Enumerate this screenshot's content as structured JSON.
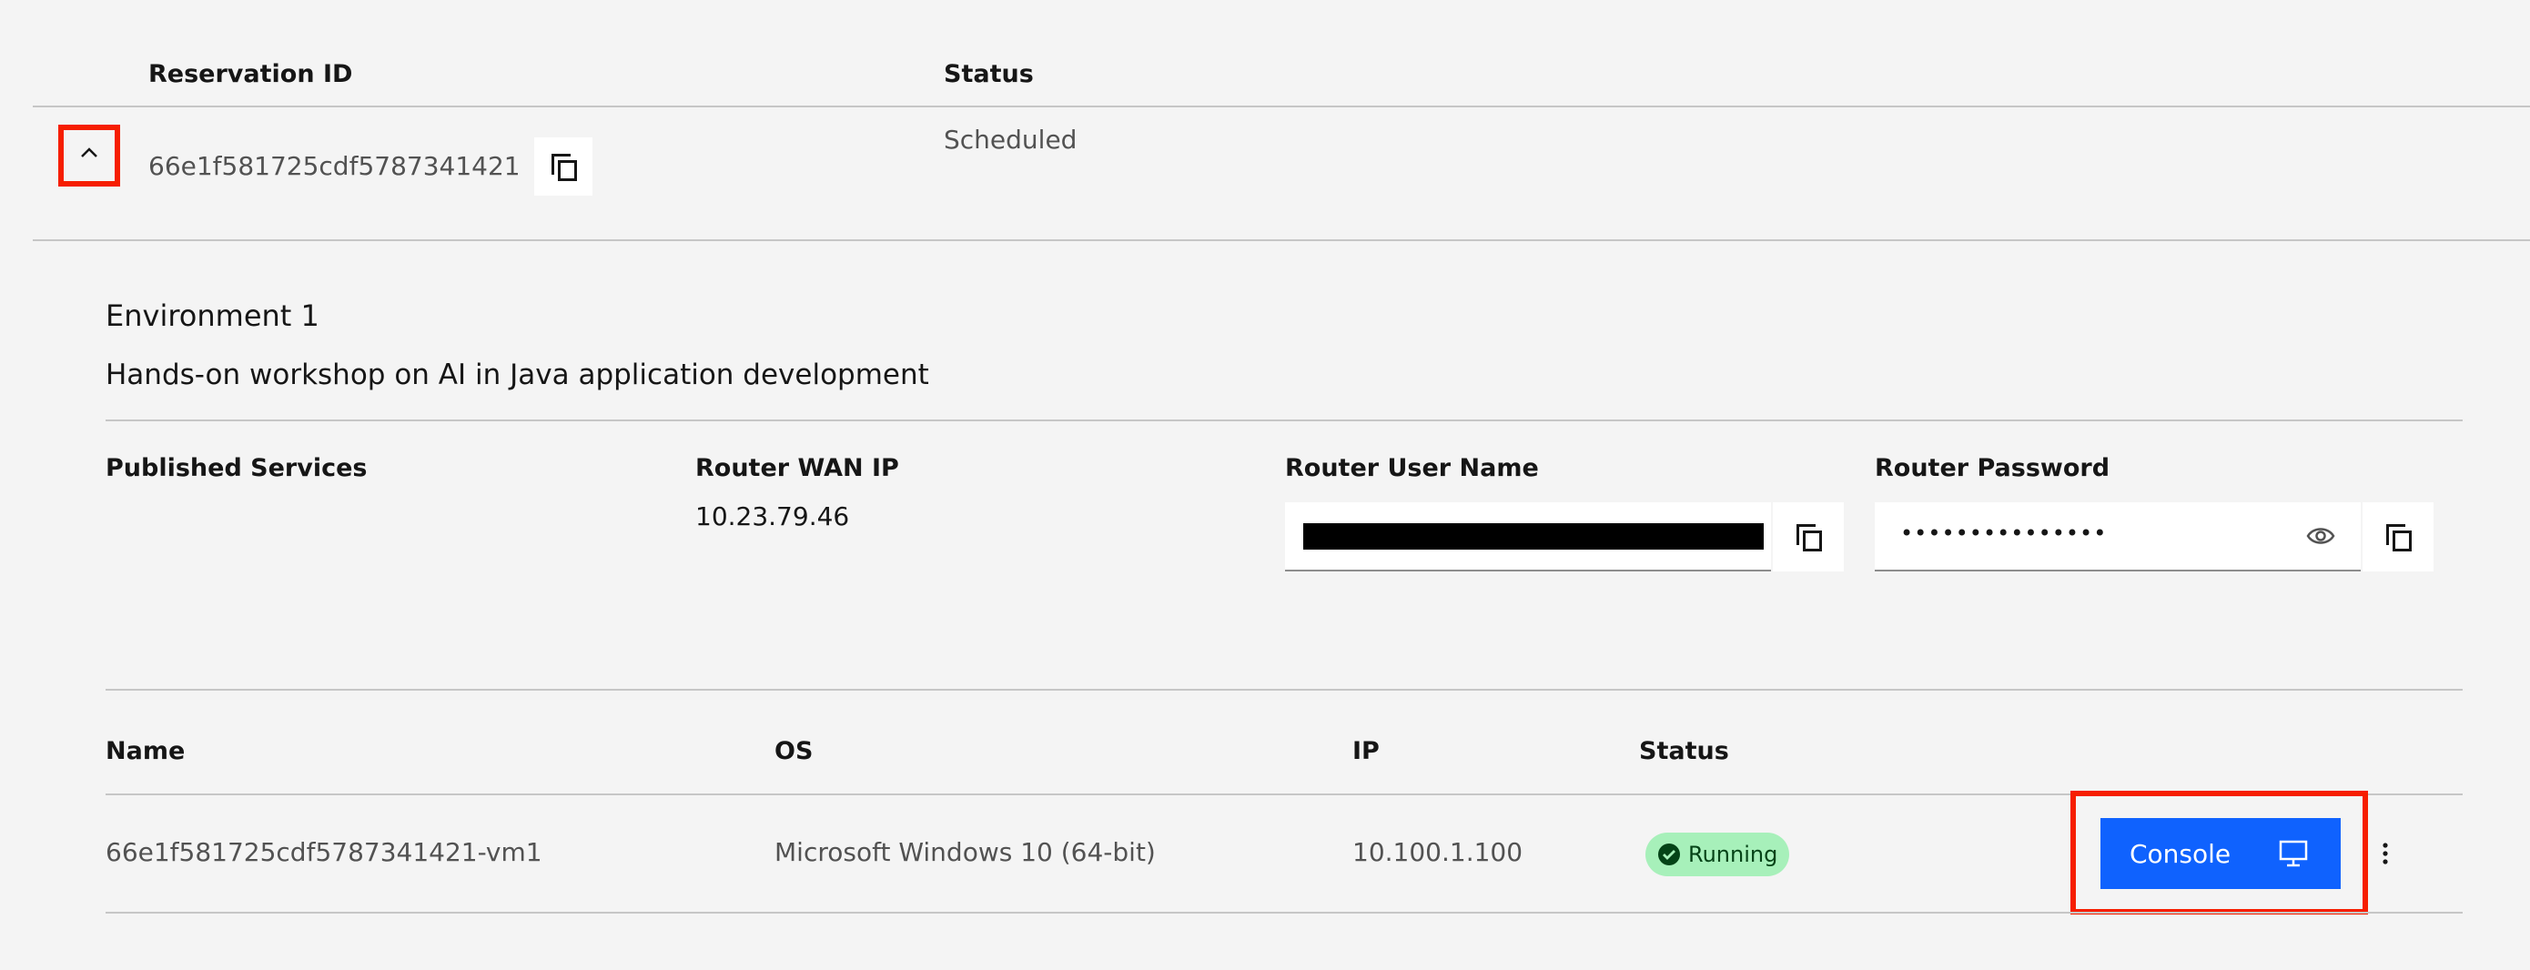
{
  "reservations_table": {
    "col_reservation_id": "Reservation ID",
    "col_status": "Status",
    "row": {
      "reservation_id": "66e1f581725cdf5787341421",
      "status": "Scheduled"
    }
  },
  "environment": {
    "title": "Environment 1",
    "description": "Hands-on workshop on AI in Java application development",
    "published_services_label": "Published Services",
    "router_wan_ip_label": "Router WAN IP",
    "router_wan_ip": "10.23.79.46",
    "router_user_name_label": "Router User Name",
    "router_password_label": "Router Password",
    "router_password_masked": "•••••••••••••••"
  },
  "vm_table": {
    "col_name": "Name",
    "col_os": "OS",
    "col_ip": "IP",
    "col_status": "Status",
    "rows": [
      {
        "name": "66e1f581725cdf5787341421-vm1",
        "os": "Microsoft Windows 10 (64-bit)",
        "ip": "10.100.1.100",
        "status": "Running",
        "console_label": "Console"
      }
    ]
  },
  "colors": {
    "background": "#f4f4f4",
    "primary_button": "#0f62fe",
    "running_badge_bg": "#a7f0ba",
    "running_badge_text": "#044317",
    "highlight_border": "#f61e00"
  },
  "icons": {
    "expand_toggle": "chevron-up-icon",
    "copy": "copy-icon",
    "show_password": "eye-icon",
    "status_ok": "checkmark-filled-icon",
    "console": "monitor-icon",
    "overflow": "overflow-menu-vertical-icon"
  }
}
